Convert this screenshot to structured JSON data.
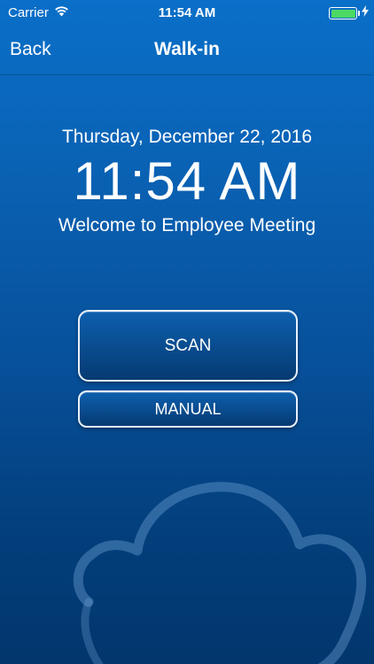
{
  "status_bar": {
    "carrier": "Carrier",
    "time": "11:54 AM",
    "battery_level": 1.0,
    "icons": [
      "wifi-icon",
      "battery-icon",
      "charging-bolt-icon"
    ]
  },
  "nav_bar": {
    "back_label": "Back",
    "title": "Walk-in"
  },
  "main": {
    "date": "Thursday, December 22, 2016",
    "time": "11:54 AM",
    "welcome": "Welcome to Employee Meeting",
    "scan_label": "SCAN",
    "manual_label": "MANUAL"
  },
  "colors": {
    "background_top": "#0a6fc8",
    "background_bottom": "#02366d",
    "button_border": "#e8f1fb",
    "battery_green": "#4cd964"
  },
  "decor": {
    "logo": "cloud-logo-icon"
  }
}
